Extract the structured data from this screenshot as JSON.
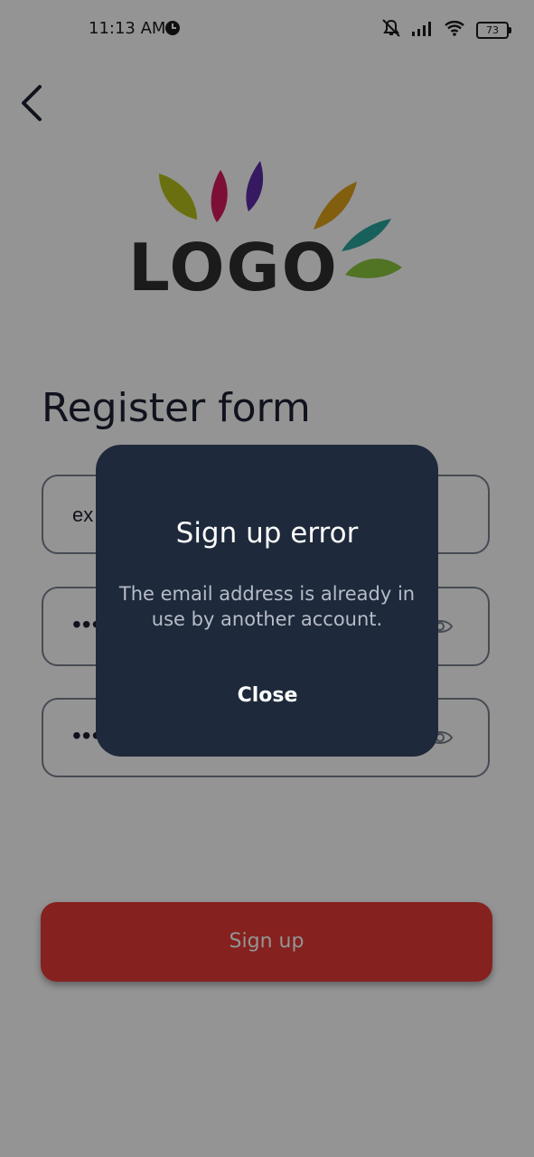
{
  "status_bar": {
    "time": "11:13 AM",
    "battery": "73",
    "icons": [
      "clock-icon",
      "silent-icon",
      "signal-icon",
      "wifi-icon",
      "battery-icon"
    ]
  },
  "nav": {
    "back_icon": "chevron-left-icon"
  },
  "logo": {
    "text": "LOGO",
    "petal_colors": [
      "#b7c11a",
      "#d81b60",
      "#5e2ca5",
      "#e0a21b",
      "#2aa69d",
      "#8cc63f"
    ]
  },
  "form": {
    "title": "Register form",
    "email_value": "ex",
    "password_value": "•••",
    "confirm_password_value": "•••"
  },
  "signup_button": {
    "label": "Sign up",
    "color": "#e53935"
  },
  "dialog": {
    "title": "Sign up error",
    "message": "The email address is already in use by another account.",
    "close_label": "Close",
    "background": "#1e293b"
  }
}
